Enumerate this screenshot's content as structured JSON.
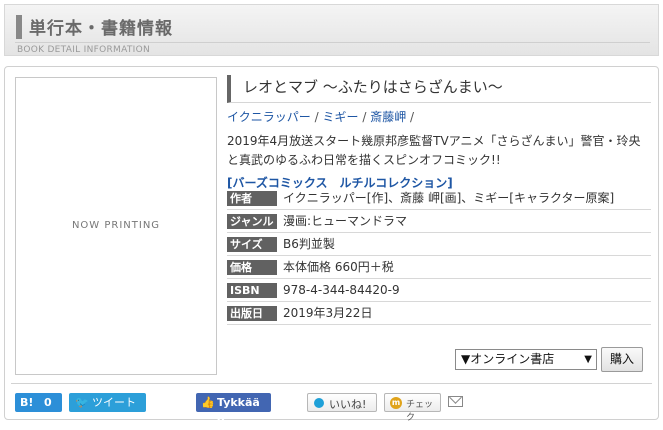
{
  "header": {
    "title": "単行本・書籍情報",
    "subtitle": "BOOK DETAIL INFORMATION"
  },
  "cover": {
    "placeholder": "NOW PRINTING"
  },
  "book": {
    "title": "レオとマブ 〜ふたりはさらざんまい〜",
    "authors": [
      "イクニラッパー",
      "ミギー",
      "斎藤岬"
    ],
    "separator": "/",
    "description": "2019年4月放送スタート幾原邦彦監督TVアニメ「さらざんまい」警官・玲央と真武のゆるふわ日常を描くスピンオフコミック!!",
    "label": "[バーズコミックス　ルチルコレクション]"
  },
  "details": [
    {
      "key": "作者",
      "value": "イクニラッパー[作]、斎藤 岬[画]、ミギー[キャラクター原案]"
    },
    {
      "key": "ジャンル",
      "value": "漫画:ヒューマンドラマ"
    },
    {
      "key": "サイズ",
      "value": "B6判並製"
    },
    {
      "key": "価格",
      "value": "本体価格 660円＋税"
    },
    {
      "key": "ISBN",
      "value": "978-4-344-84420-9"
    },
    {
      "key": "出版日",
      "value": "2019年3月22日"
    }
  ],
  "purchase": {
    "store_select": "▼オンライン書店",
    "buy_label": "購入"
  },
  "social": {
    "hatena_logo": "B!",
    "hatena_count": "0",
    "tweet_label": "ツイート",
    "facebook_label": "Tykkää 0",
    "iine_label": "いいね!",
    "mixi_label": "チェック",
    "icons": {
      "twitter": "twitter-bird-icon",
      "facebook": "thumbs-up-icon",
      "mail": "mail-icon"
    }
  },
  "colors": {
    "link": "#1e56a4",
    "key_bg": "#616161",
    "hatena": "#2c8fd8",
    "twitter": "#2c9fd9",
    "facebook": "#4266b2"
  }
}
